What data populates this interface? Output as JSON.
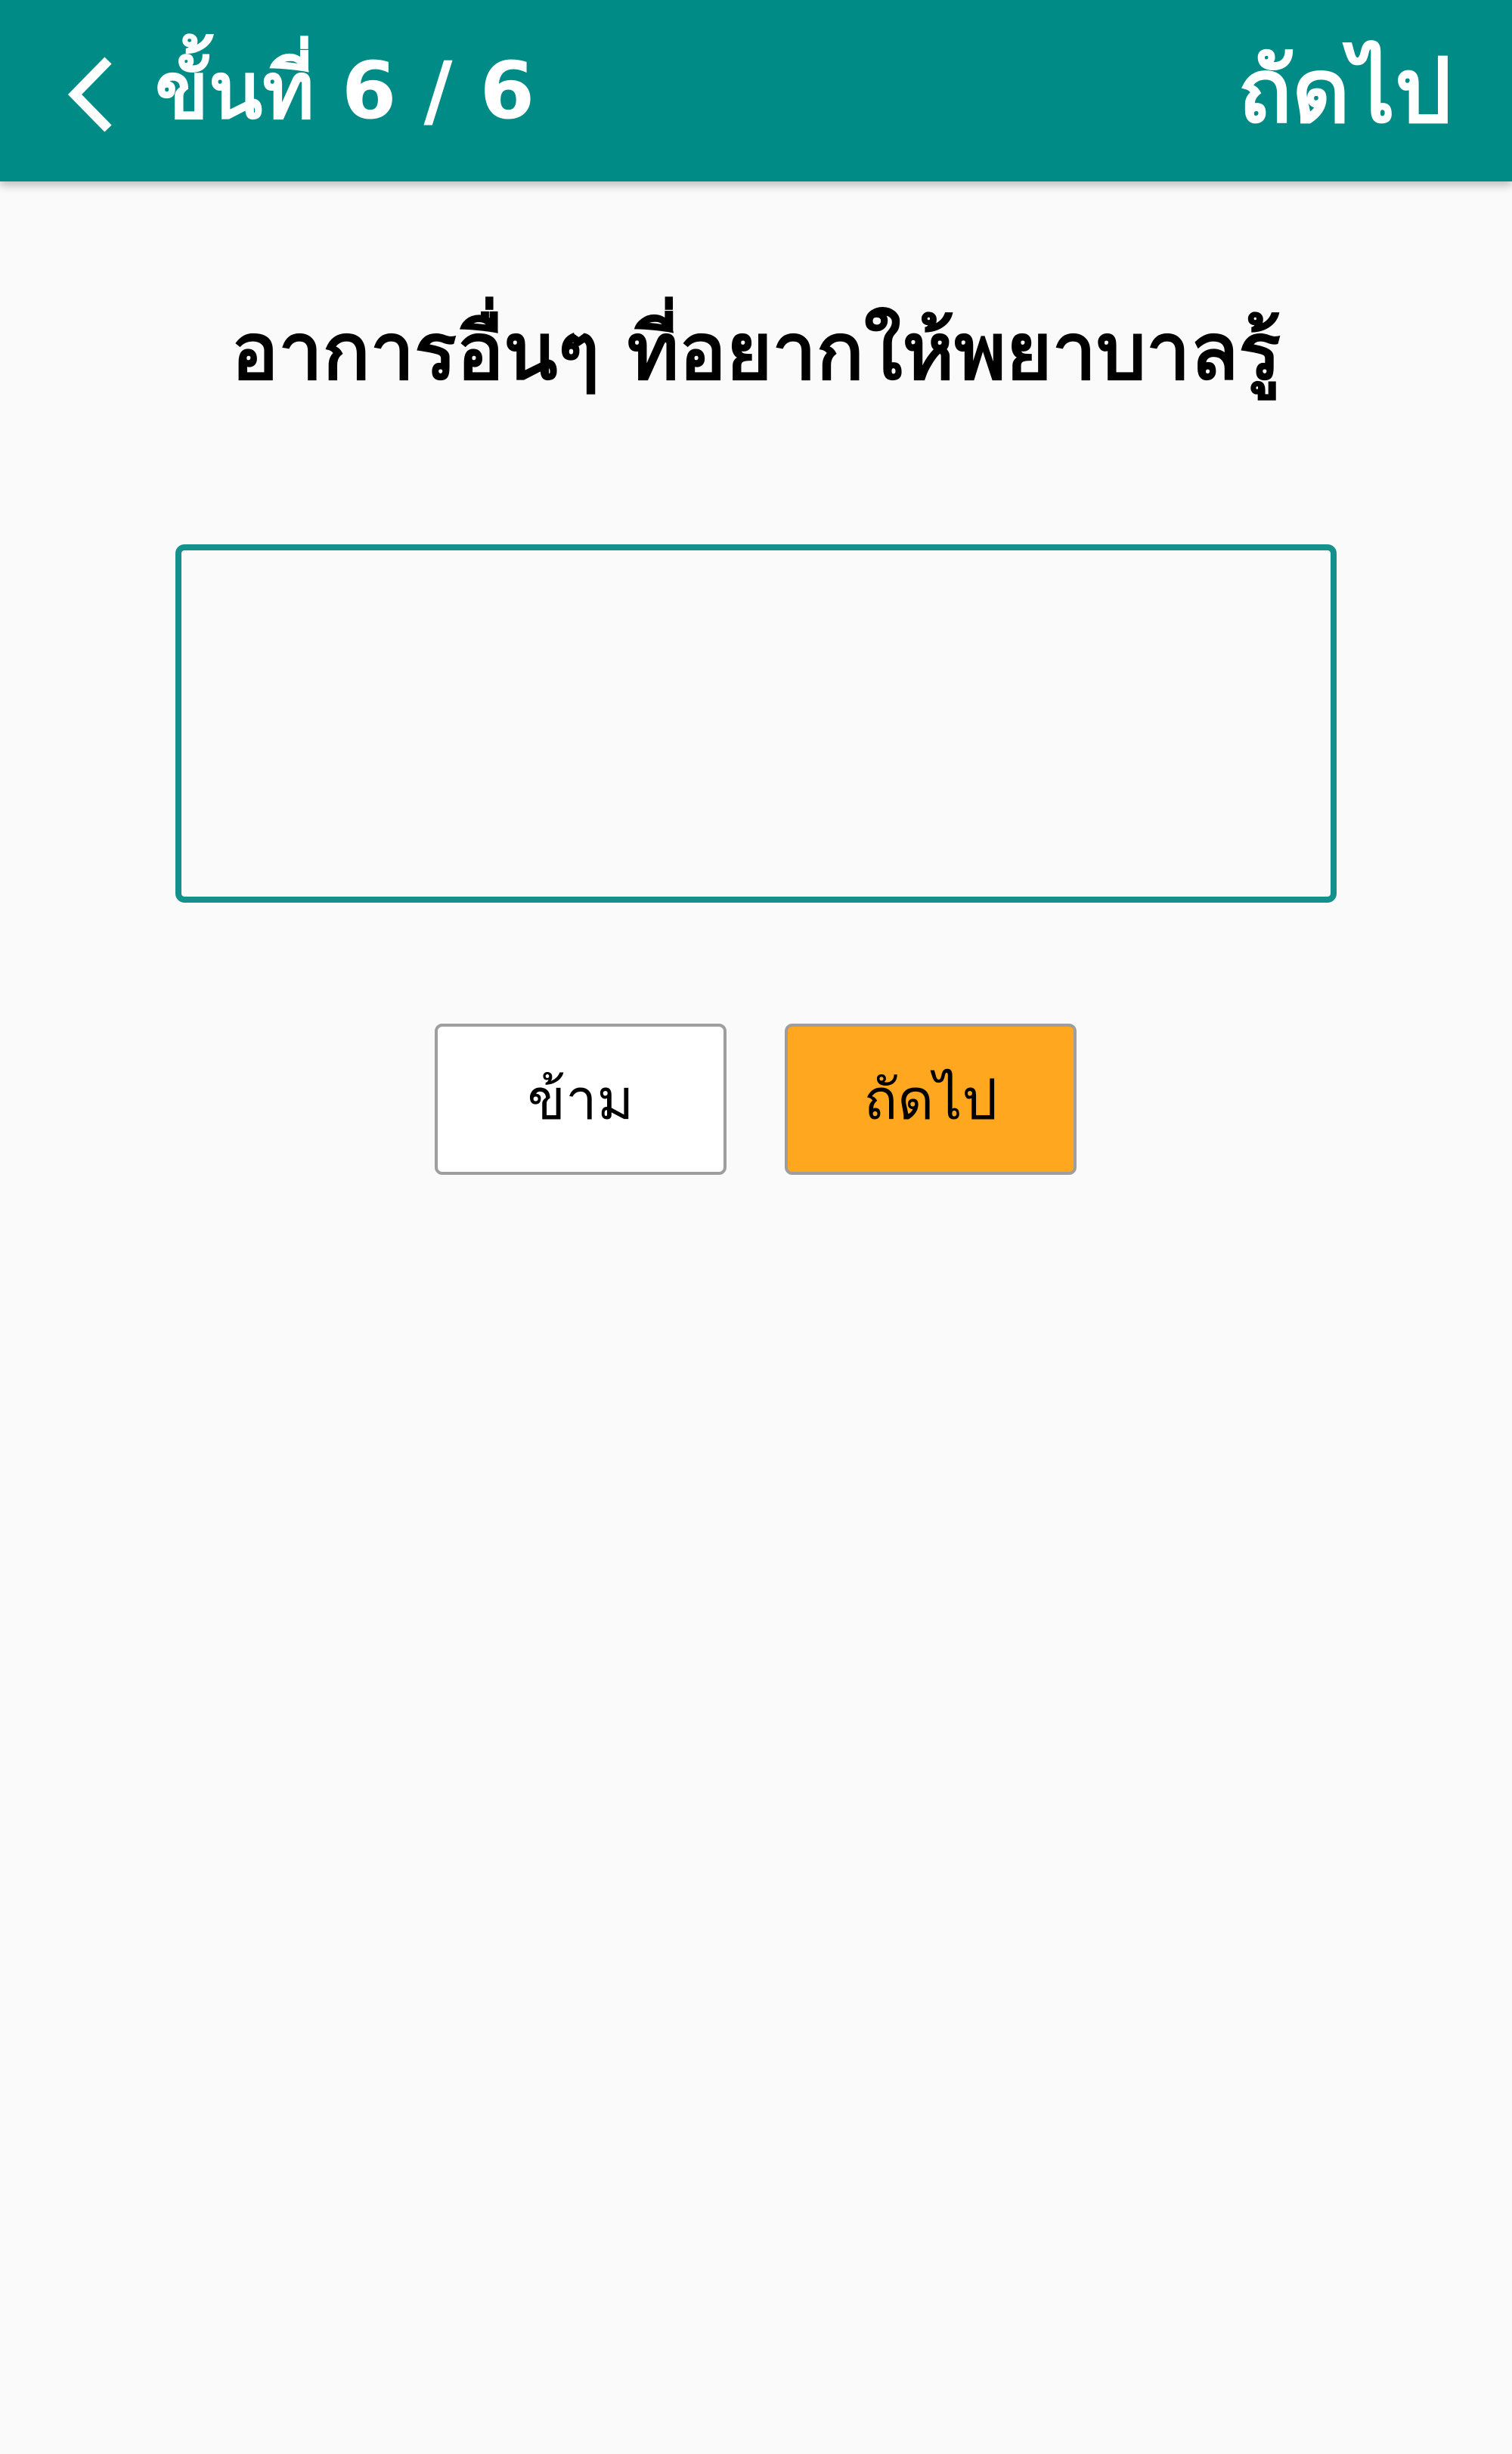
{
  "app_bar": {
    "back_icon": "chevron-left-icon",
    "step_title": "ขั้นที่ 6 / 6",
    "next_label": "ถัดไป",
    "background_color": "#008b87"
  },
  "form": {
    "question": "อาการอื่นๆ ที่อยากให้พยาบาลรู้",
    "answer_value": "",
    "input_border_color": "#14918c"
  },
  "actions": {
    "skip_label": "ข้าม",
    "next_label": "ถัดไป",
    "next_color": "#ffa71f"
  }
}
